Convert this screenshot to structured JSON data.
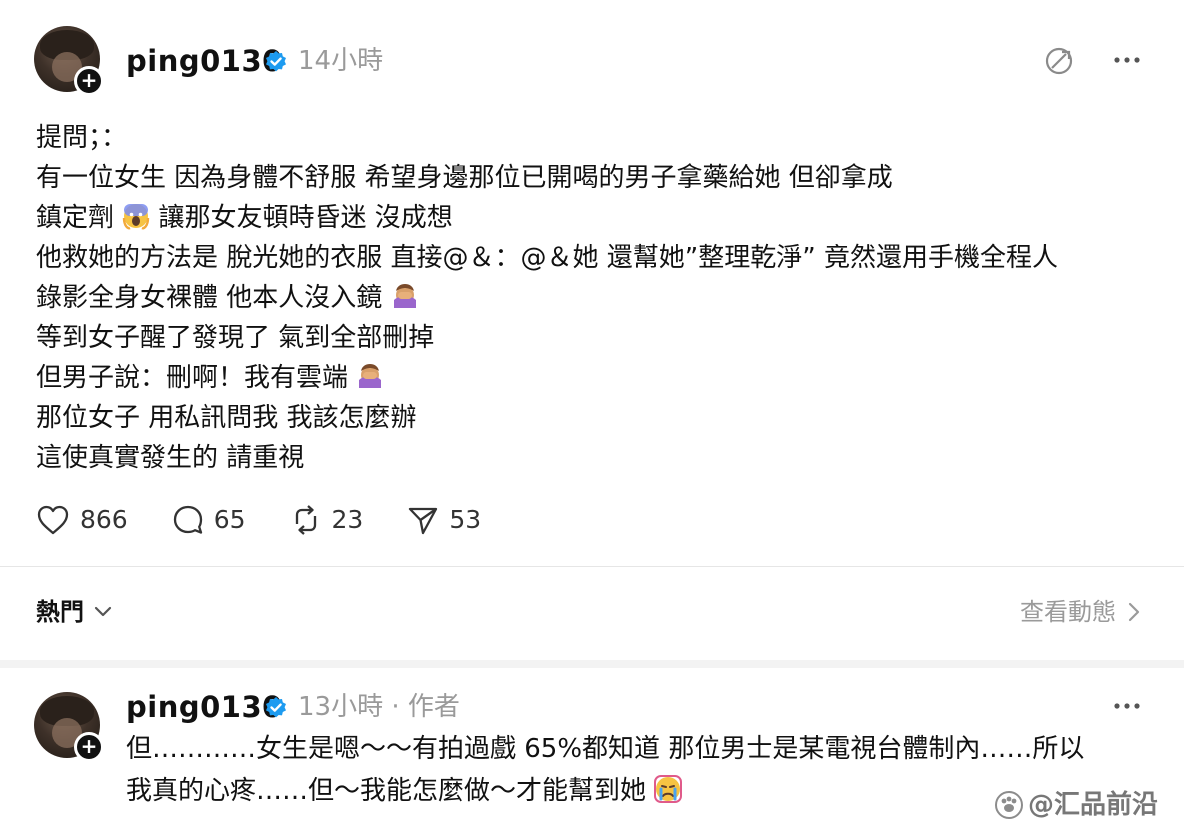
{
  "post": {
    "username": "ping0130",
    "time": "14小時",
    "lines": [
      "提問；：",
      "有一位女生 因為身體不舒服 希望身邊那位已開喝的男子拿藥給她 但卻拿成",
      "鎮定劑",
      "讓那女友頓時昏迷 沒成想",
      "他救她的方法是 脫光她的衣服 直接@＆：@＆她 還幫她”整理乾淨” 竟然還用手機全程人",
      "錄影全身女裸體 他本人沒入鏡",
      "等到女子醒了發現了 氣到全部刪掉",
      "但男子說：刪啊！我有雲端",
      "那位女子 用私訊問我 我該怎麼辦",
      "這使真實發生的 請重視"
    ],
    "emoji_icons": [
      "screaming-face-emoji",
      "facepalm-emoji",
      "facepalm-emoji"
    ],
    "counts": {
      "likes": "866",
      "comments": "65",
      "reposts": "23",
      "shares": "53"
    }
  },
  "sortbar": {
    "label": "熱門",
    "activity_link": "查看動態"
  },
  "reply": {
    "username": "ping0130",
    "meta": "13小時 · 作者",
    "lines": [
      "但…………女生是嗯～～有拍過戲 65%都知道 那位男士是某電視台體制內……所以",
      "我真的心疼……但～我能怎麼做～才能幫到她"
    ]
  },
  "watermark": {
    "text": "@汇品前沿"
  },
  "colors": {
    "verified": "#1d9bf0",
    "muted": "#9a9a9a",
    "text": "#111111"
  }
}
